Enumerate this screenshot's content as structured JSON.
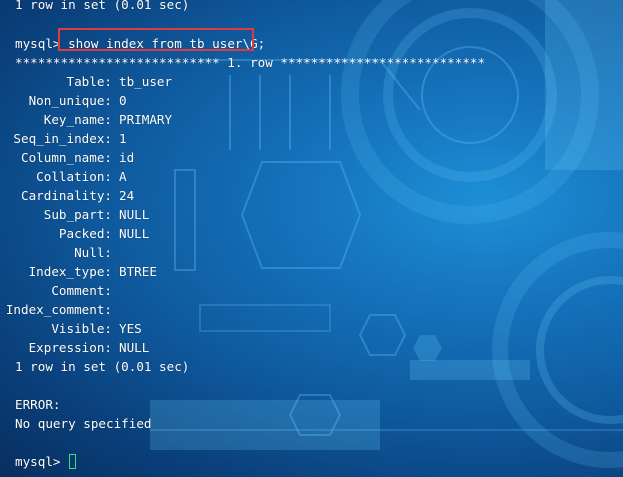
{
  "terminal": {
    "previous_result": "1 row in set (0.01 sec)",
    "prompt": "mysql>",
    "command": "show index from tb_user\\G;",
    "row_separator": "*************************** 1. row ***************************",
    "fields": [
      {
        "name": "Table:",
        "value": "tb_user"
      },
      {
        "name": "Non_unique:",
        "value": "0"
      },
      {
        "name": "Key_name:",
        "value": "PRIMARY"
      },
      {
        "name": "Seq_in_index:",
        "value": "1"
      },
      {
        "name": "Column_name:",
        "value": "id"
      },
      {
        "name": "Collation:",
        "value": "A"
      },
      {
        "name": "Cardinality:",
        "value": "24"
      },
      {
        "name": "Sub_part:",
        "value": "NULL"
      },
      {
        "name": "Packed:",
        "value": "NULL"
      },
      {
        "name": "Null:",
        "value": ""
      },
      {
        "name": "Index_type:",
        "value": "BTREE"
      },
      {
        "name": "Comment:",
        "value": ""
      },
      {
        "name": "Index_comment:",
        "value": ""
      },
      {
        "name": "Visible:",
        "value": "YES"
      },
      {
        "name": "Expression:",
        "value": "NULL"
      }
    ],
    "result_summary": "1 row in set (0.01 sec)",
    "error_label": "ERROR:",
    "error_message": "No query specified",
    "final_prompt": "mysql>"
  },
  "colors": {
    "highlight_border": "#e0393e",
    "cursor": "#36e07a",
    "text": "#ffffff"
  }
}
